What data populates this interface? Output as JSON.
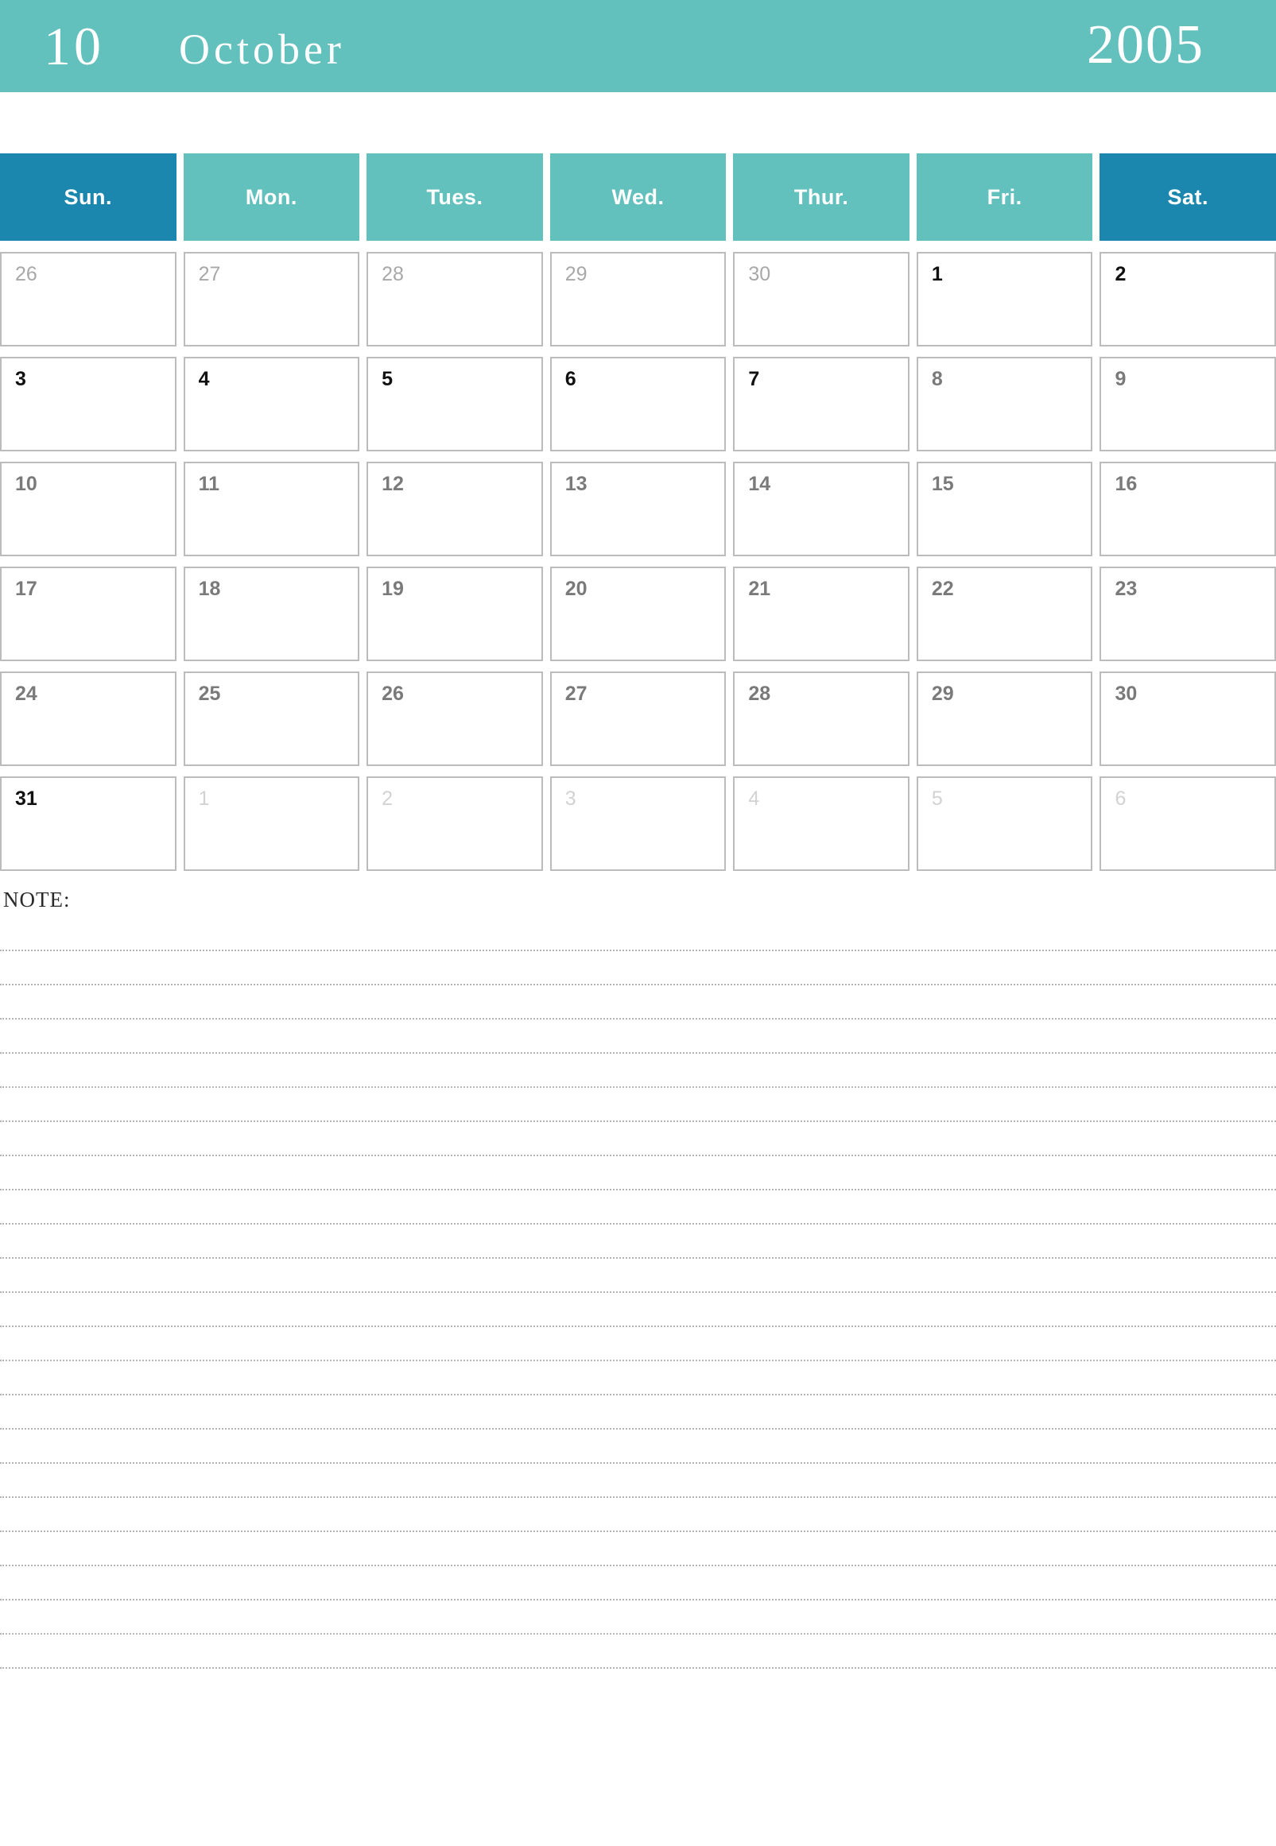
{
  "header": {
    "month_number": "10",
    "month_name": "October",
    "year": "2005",
    "band_color": "#62c0bd"
  },
  "weekdays": [
    {
      "label": "Sun.",
      "weekend": true
    },
    {
      "label": "Mon.",
      "weekend": false
    },
    {
      "label": "Tues.",
      "weekend": false
    },
    {
      "label": "Wed.",
      "weekend": false
    },
    {
      "label": "Thur.",
      "weekend": false
    },
    {
      "label": "Fri.",
      "weekend": false
    },
    {
      "label": "Sat.",
      "weekend": true
    }
  ],
  "colors": {
    "accent_teal": "#62c0bd",
    "accent_blue": "#1b87af",
    "cell_border": "#bcbcbc",
    "day_current": "#111111",
    "day_muted": "#7a7a7a",
    "day_outside": "#a8a8a8",
    "day_faint": "#d2d2d2"
  },
  "weeks": [
    [
      {
        "day": "26",
        "tone": "outside"
      },
      {
        "day": "27",
        "tone": "outside"
      },
      {
        "day": "28",
        "tone": "outside"
      },
      {
        "day": "29",
        "tone": "outside"
      },
      {
        "day": "30",
        "tone": "outside"
      },
      {
        "day": "1",
        "tone": "current"
      },
      {
        "day": "2",
        "tone": "current"
      }
    ],
    [
      {
        "day": "3",
        "tone": "current"
      },
      {
        "day": "4",
        "tone": "current"
      },
      {
        "day": "5",
        "tone": "current"
      },
      {
        "day": "6",
        "tone": "current"
      },
      {
        "day": "7",
        "tone": "current"
      },
      {
        "day": "8",
        "tone": "muted"
      },
      {
        "day": "9",
        "tone": "muted"
      }
    ],
    [
      {
        "day": "10",
        "tone": "muted"
      },
      {
        "day": "11",
        "tone": "muted"
      },
      {
        "day": "12",
        "tone": "muted"
      },
      {
        "day": "13",
        "tone": "muted"
      },
      {
        "day": "14",
        "tone": "muted"
      },
      {
        "day": "15",
        "tone": "muted"
      },
      {
        "day": "16",
        "tone": "muted"
      }
    ],
    [
      {
        "day": "17",
        "tone": "muted"
      },
      {
        "day": "18",
        "tone": "muted"
      },
      {
        "day": "19",
        "tone": "muted"
      },
      {
        "day": "20",
        "tone": "muted"
      },
      {
        "day": "21",
        "tone": "muted"
      },
      {
        "day": "22",
        "tone": "muted"
      },
      {
        "day": "23",
        "tone": "muted"
      }
    ],
    [
      {
        "day": "24",
        "tone": "muted"
      },
      {
        "day": "25",
        "tone": "muted"
      },
      {
        "day": "26",
        "tone": "muted"
      },
      {
        "day": "27",
        "tone": "muted"
      },
      {
        "day": "28",
        "tone": "muted"
      },
      {
        "day": "29",
        "tone": "muted"
      },
      {
        "day": "30",
        "tone": "muted"
      }
    ],
    [
      {
        "day": "31",
        "tone": "current"
      },
      {
        "day": "1",
        "tone": "faint"
      },
      {
        "day": "2",
        "tone": "faint"
      },
      {
        "day": "3",
        "tone": "faint"
      },
      {
        "day": "4",
        "tone": "faint"
      },
      {
        "day": "5",
        "tone": "faint"
      },
      {
        "day": "6",
        "tone": "faint"
      }
    ]
  ],
  "note": {
    "label": "NOTE:",
    "line_count": 22
  }
}
